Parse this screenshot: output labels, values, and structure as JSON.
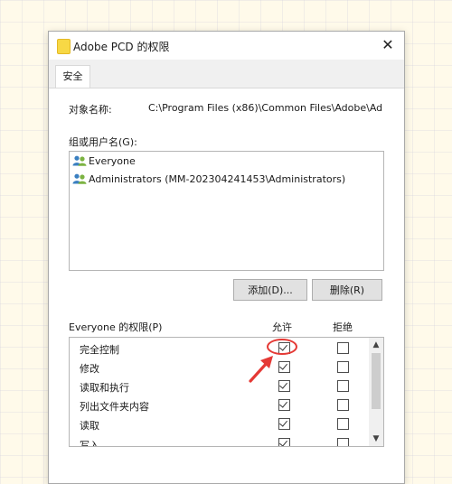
{
  "window": {
    "title": "Adobe PCD 的权限",
    "close_glyph": "✕"
  },
  "tabs": [
    {
      "label": "安全",
      "selected": true
    }
  ],
  "security": {
    "object_name_label": "对象名称:",
    "object_name_value": "C:\\Program Files (x86)\\Common Files\\Adobe\\Ad",
    "groups_label": "组或用户名(G):",
    "users": [
      {
        "name": "Everyone",
        "icon": "users-icon"
      },
      {
        "name": "Administrators (MM-202304241453\\Administrators)",
        "icon": "users-icon"
      }
    ],
    "add_button": "添加(D)...",
    "remove_button": "删除(R)",
    "permissions_label": "Everyone 的权限(P)",
    "allow_header": "允许",
    "deny_header": "拒绝",
    "permissions": [
      {
        "name": "完全控制",
        "allow": true,
        "deny": false
      },
      {
        "name": "修改",
        "allow": true,
        "deny": false
      },
      {
        "name": "读取和执行",
        "allow": true,
        "deny": false
      },
      {
        "name": "列出文件夹内容",
        "allow": true,
        "deny": false
      },
      {
        "name": "读取",
        "allow": true,
        "deny": false
      },
      {
        "name": "写入",
        "allow": true,
        "deny": false
      }
    ]
  },
  "colors": {
    "annotation": "#e53935",
    "folder_icon": "#f7d845",
    "background": "#fffaea"
  }
}
